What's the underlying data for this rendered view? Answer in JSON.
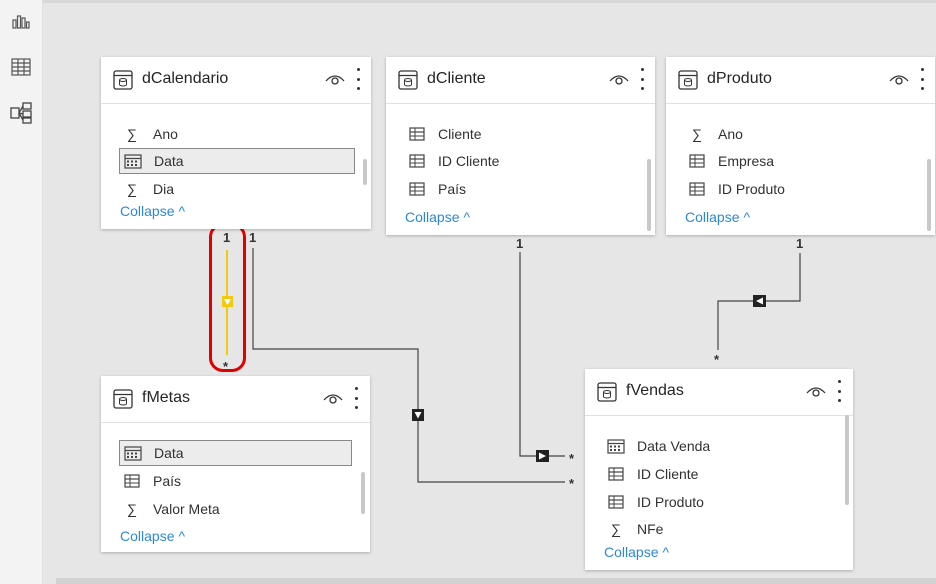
{
  "colors": {
    "highlight": "#e00000",
    "active_relationship": "#f2c811",
    "relationship": "#444444",
    "link": "#2b88d8"
  },
  "rail": {
    "icons": [
      "report-view-icon",
      "data-view-icon",
      "model-view-icon"
    ]
  },
  "tables": {
    "dCalendario": {
      "title": "dCalendario",
      "collapse": "Collapse",
      "fields": [
        {
          "label": "Ano",
          "icon": "sigma-icon"
        },
        {
          "label": "Data",
          "icon": "calendar-icon",
          "selected": true
        },
        {
          "label": "Dia",
          "icon": "sigma-icon"
        }
      ]
    },
    "dCliente": {
      "title": "dCliente",
      "collapse": "Collapse",
      "fields": [
        {
          "label": "Cliente",
          "icon": "table-icon"
        },
        {
          "label": "ID Cliente",
          "icon": "table-icon"
        },
        {
          "label": "País",
          "icon": "table-icon"
        }
      ]
    },
    "dProduto": {
      "title": "dProduto",
      "collapse": "Collapse",
      "fields": [
        {
          "label": "Ano",
          "icon": "sigma-icon"
        },
        {
          "label": "Empresa",
          "icon": "table-icon"
        },
        {
          "label": "ID Produto",
          "icon": "table-icon"
        }
      ]
    },
    "fMetas": {
      "title": "fMetas",
      "collapse": "Collapse",
      "fields": [
        {
          "label": "Data",
          "icon": "calendar-icon",
          "selected": true
        },
        {
          "label": "País",
          "icon": "table-icon"
        },
        {
          "label": "Valor Meta",
          "icon": "sigma-icon"
        }
      ]
    },
    "fVendas": {
      "title": "fVendas",
      "collapse": "Collapse",
      "fields": [
        {
          "label": "Data Venda",
          "icon": "calendar-icon"
        },
        {
          "label": "ID Cliente",
          "icon": "table-icon"
        },
        {
          "label": "ID Produto",
          "icon": "table-icon"
        },
        {
          "label": "NFe",
          "icon": "sigma-icon"
        }
      ]
    }
  },
  "relationships": {
    "cal_metas": {
      "from_card": "1",
      "to_card": "*"
    },
    "cal_vendas": {
      "from_card": "1",
      "to_card": "*"
    },
    "cliente_vendas": {
      "from_card": "1",
      "to_card": "*"
    },
    "produto_vendas": {
      "from_card": "1",
      "to_card": "*"
    }
  }
}
